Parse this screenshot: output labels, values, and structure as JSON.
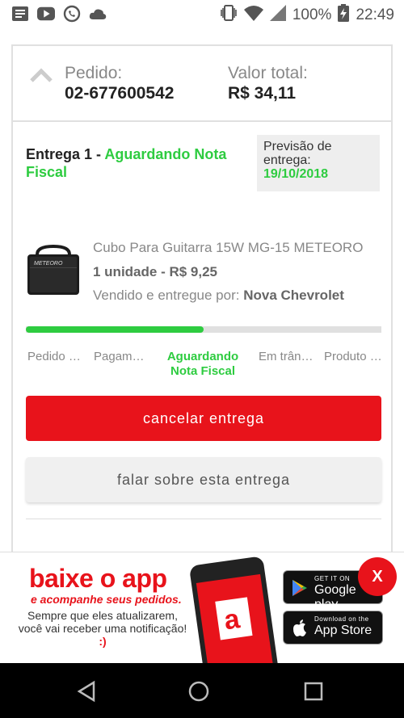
{
  "status_bar": {
    "icons_left": [
      "notes-icon",
      "youtube-icon",
      "whatsapp-icon",
      "cloud-icon"
    ],
    "battery_percent": "100%",
    "time": "22:49"
  },
  "order": {
    "order_label": "Pedido:",
    "order_number": "02-677600542",
    "total_label": "Valor total:",
    "total_value": "R$ 34,11"
  },
  "delivery": {
    "title_prefix": "Entrega 1 - ",
    "status": "Aguardando Nota Fiscal",
    "forecast_label": "Previsão de entrega:",
    "forecast_date": "19/10/2018"
  },
  "product": {
    "name": "Cubo Para Guitarra 15W MG-15 METEORO",
    "brand_on_image": "METEORO",
    "quantity_price": "1 unidade - R$ 9,25",
    "seller_label": "Vendido e entregue por: ",
    "seller_name": "Nova Chevrolet"
  },
  "progress": {
    "fraction": 0.5,
    "steps": [
      {
        "label": "Pedido realizado"
      },
      {
        "label": "Pagamento aprovado"
      },
      {
        "label": "Aguardando Nota Fiscal"
      },
      {
        "label": "Em trânsito"
      },
      {
        "label": "Produto entregue"
      }
    ]
  },
  "actions": {
    "cancel_label": "cancelar entrega",
    "talk_label": "falar sobre esta entrega"
  },
  "banner": {
    "title": "baixe o app",
    "subtitle": "e acompanhe seus pedidos.",
    "text": "Sempre que eles atualizarem, você vai receber uma notificação!",
    "smile": ":)",
    "google_small": "GET IT ON",
    "google_big": "Google play",
    "apple_small": "Download on the",
    "apple_big": "App Store",
    "close_label": "X"
  },
  "colors": {
    "accent_red": "#e8131b",
    "status_green": "#2ecc40",
    "border_gray": "#e0e0e0"
  }
}
